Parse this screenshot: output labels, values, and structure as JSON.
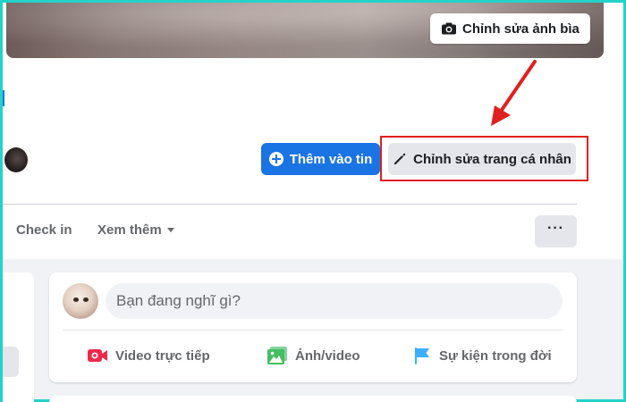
{
  "cover": {
    "edit_label": "Chỉnh sửa ảnh bìa",
    "edit_icon": "camera-icon"
  },
  "profile_actions": {
    "add_story_label": "Thêm vào tin",
    "add_story_icon": "plus-circle-icon",
    "edit_profile_label": "Chỉnh sửa trang cá nhân",
    "edit_profile_icon": "pencil-icon",
    "highlight_color": "#e02020",
    "add_story_color": "#1b74e4"
  },
  "tabs": {
    "checkin_label": "Check in",
    "more_label": "Xem thêm",
    "more_icon": "caret-down-icon",
    "overflow_label": "···"
  },
  "composer": {
    "placeholder": "Bạn đang nghĩ gì?",
    "actions": [
      {
        "label": "Video trực tiếp",
        "icon": "live-video-icon",
        "color": "#f02849"
      },
      {
        "label": "Ảnh/video",
        "icon": "photo-icon",
        "color": "#45bd62"
      },
      {
        "label": "Sự kiện trong đời",
        "icon": "flag-icon",
        "color": "#3ab0ff"
      }
    ]
  }
}
